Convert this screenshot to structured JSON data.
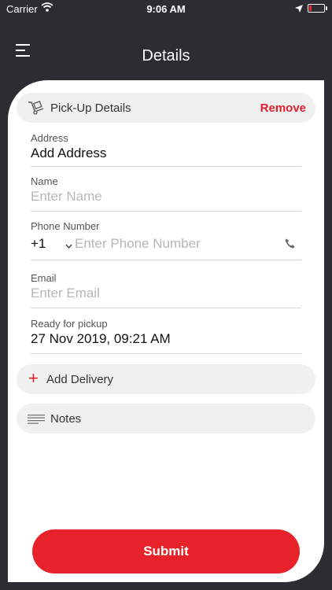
{
  "status_bar": {
    "carrier": "Carrier",
    "time": "9:06 AM"
  },
  "header": {
    "title": "Details"
  },
  "pickup": {
    "section_label": "Pick-Up Details",
    "remove_label": "Remove",
    "address": {
      "label": "Address",
      "value": "Add Address"
    },
    "name": {
      "label": "Name",
      "placeholder": "Enter Name"
    },
    "phone": {
      "label": "Phone Number",
      "country_code": "+1",
      "placeholder": "Enter Phone Number"
    },
    "email": {
      "label": "Email",
      "placeholder": "Enter Email"
    },
    "ready": {
      "label": "Ready for pickup",
      "value": "27 Nov 2019, 09:21 AM"
    }
  },
  "add_delivery": {
    "label": "Add Delivery"
  },
  "notes": {
    "label": "Notes"
  },
  "submit": {
    "label": "Submit"
  },
  "colors": {
    "accent": "#e8222a",
    "background": "#2c2d33",
    "section_bg": "#f0f0f0"
  },
  "icons": {
    "menu": "hamburger-icon",
    "pickup": "hand-truck-icon",
    "dropdown": "chevron-down-icon",
    "phone": "phone-icon",
    "add": "plus-icon",
    "notes": "notes-lines-icon",
    "wifi": "wifi-icon",
    "location": "location-arrow-icon",
    "battery": "battery-icon"
  }
}
